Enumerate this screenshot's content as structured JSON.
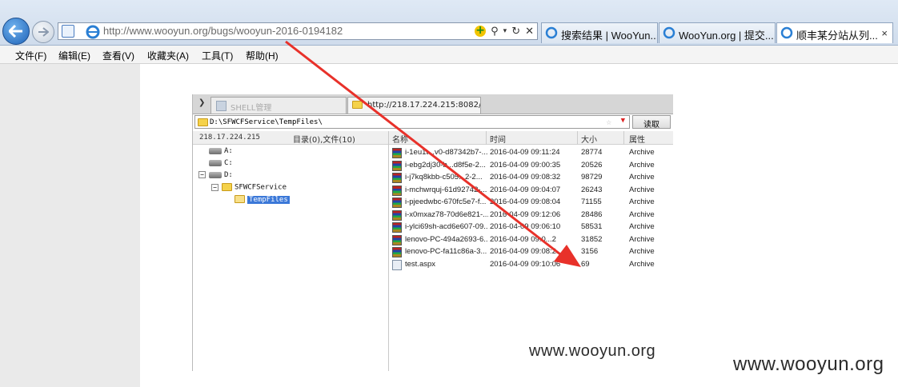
{
  "browser": {
    "address_url": "http://www.wooyun.org/bugs/wooyun-2016-0194182",
    "tabs": [
      {
        "label": "搜索结果 | WooYun..."
      },
      {
        "label": "WooYun.org | 提交..."
      },
      {
        "label": "顺丰某分站从列...",
        "close": "×"
      }
    ],
    "menu": [
      "文件(F)",
      "编辑(E)",
      "查看(V)",
      "收藏夹(A)",
      "工具(T)",
      "帮助(H)"
    ]
  },
  "shell": {
    "tabs": [
      {
        "label": "SHELL管理"
      },
      {
        "label": "http://218.17.224.215:8082/Te..."
      }
    ],
    "path": "D:\\SFWCFService\\TempFiles\\",
    "read_button": "读取",
    "host": "218.17.224.215",
    "summary": "目录(0),文件(10)",
    "tree": [
      {
        "label": "A:"
      },
      {
        "label": "C:"
      },
      {
        "label": "D:"
      },
      {
        "label": "SFWCFService"
      },
      {
        "label": "TempFiles"
      }
    ],
    "columns": [
      "名称",
      "时间",
      "大小",
      "属性"
    ],
    "files": [
      {
        "name": "i-1eu1t...v0-d87342b7-...",
        "time": "2016-04-09 09:11:24",
        "size": "28774",
        "attr": "Archive"
      },
      {
        "name": "i-ebg2dj30-b...d8f5e-2...",
        "time": "2016-04-09 09:00:35",
        "size": "20526",
        "attr": "Archive"
      },
      {
        "name": "i-j7kq8kbb-c505...2-2...",
        "time": "2016-04-09 09:08:32",
        "size": "98729",
        "attr": "Archive"
      },
      {
        "name": "i-mchwrquj-61d92742-...",
        "time": "2016-04-09 09:04:07",
        "size": "26243",
        "attr": "Archive"
      },
      {
        "name": "i-pjeedwbc-670fc5e7-f...",
        "time": "2016-04-09 09:08:04",
        "size": "71155",
        "attr": "Archive"
      },
      {
        "name": "i-x0mxaz78-70d6e821-...",
        "time": "2016-04-09 09:12:06",
        "size": "28486",
        "attr": "Archive"
      },
      {
        "name": "i-ylci69sh-acd6e607-09...",
        "time": "2016-04-09 09:06:10",
        "size": "58531",
        "attr": "Archive"
      },
      {
        "name": "lenovo-PC-494a2693-6...",
        "time": "2016-04-09 09:0...2",
        "size": "31852",
        "attr": "Archive"
      },
      {
        "name": "lenovo-PC-fa11c86a-3...",
        "time": "2016-04-09 09:08:2...",
        "size": "3156",
        "attr": "Archive"
      },
      {
        "name": "test.aspx",
        "time": "2016-04-09 09:10:06",
        "size": "69",
        "attr": "Archive"
      }
    ]
  },
  "watermarks": [
    "www.wooyun.org",
    "www.wooyun.org"
  ],
  "colors": {
    "arrow": "#e8312a",
    "selection": "#3b78d8"
  }
}
